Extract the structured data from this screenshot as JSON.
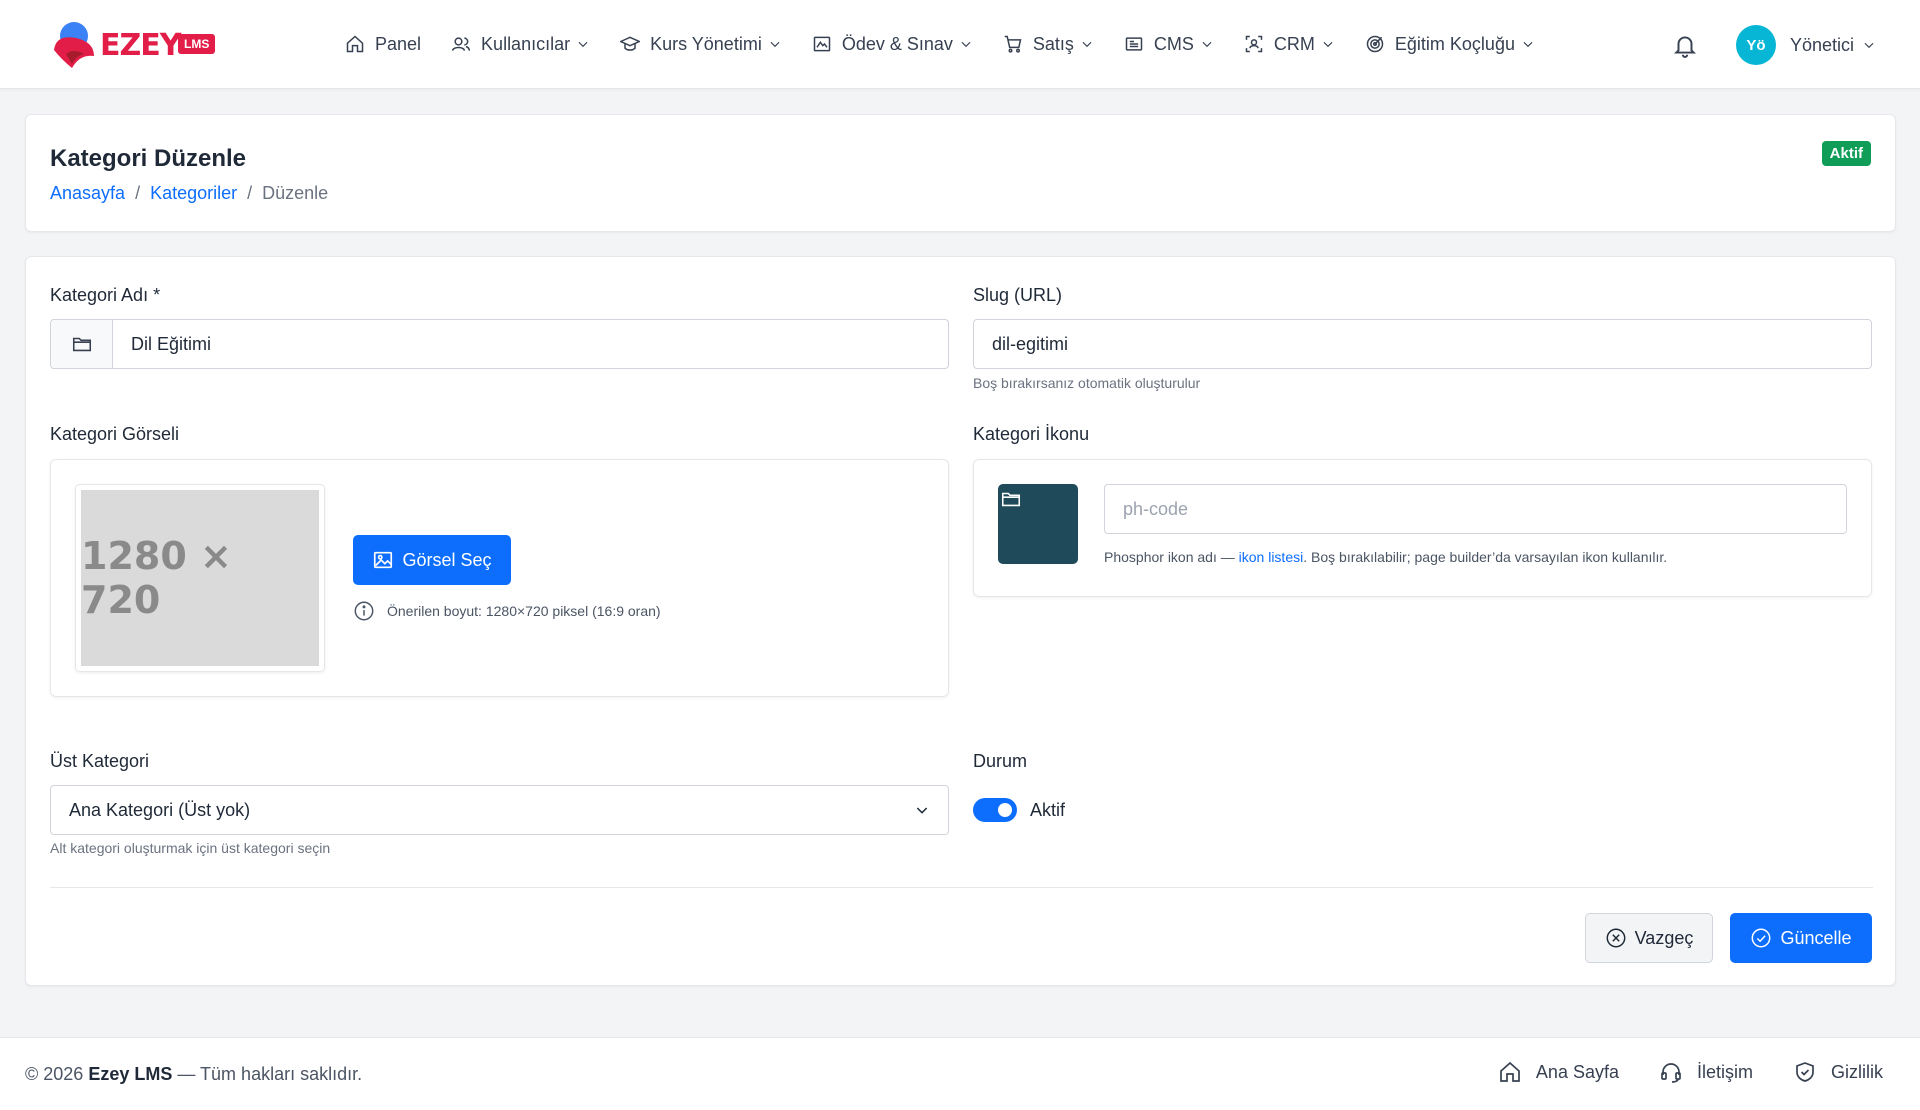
{
  "brand": {
    "name": "EZEY",
    "badge": "LMS"
  },
  "nav": {
    "items": [
      {
        "label": "Panel",
        "icon": "home-icon",
        "dropdown": false
      },
      {
        "label": "Kullanıcılar",
        "icon": "users-icon",
        "dropdown": true
      },
      {
        "label": "Kurs Yönetimi",
        "icon": "graduation-cap-icon",
        "dropdown": true
      },
      {
        "label": "Ödev & Sınav",
        "icon": "exam-icon",
        "dropdown": true
      },
      {
        "label": "Satış",
        "icon": "cart-icon",
        "dropdown": true
      },
      {
        "label": "CMS",
        "icon": "newspaper-icon",
        "dropdown": true
      },
      {
        "label": "CRM",
        "icon": "crm-icon",
        "dropdown": true
      },
      {
        "label": "Eğitim Koçluğu",
        "icon": "target-icon",
        "dropdown": true
      }
    ],
    "user": {
      "initials": "Yö",
      "name": "Yönetici"
    }
  },
  "header": {
    "title": "Kategori Düzenle",
    "breadcrumb": [
      "Anasayfa",
      "Kategoriler",
      "Düzenle"
    ],
    "status": "Aktif"
  },
  "form": {
    "name_label": "Kategori Adı *",
    "name_value": "Dil Eğitimi",
    "slug_label": "Slug (URL)",
    "slug_value": "dil-egitimi",
    "slug_help": "Boş bırakırsanız otomatik oluşturulur",
    "image_label": "Kategori Görseli",
    "image_placeholder": "1280 × 720",
    "image_button": "Görsel Seç",
    "image_hint": "Önerilen boyut: 1280×720 piksel (16:9 oran)",
    "icon_label": "Kategori İkonu",
    "icon_placeholder": "ph-code",
    "icon_help_prefix": "Phosphor ikon adı — ",
    "icon_help_link": "ikon listesi",
    "icon_help_suffix": ". Boş bırakılabilir; page builder’da varsayılan ikon kullanılır.",
    "icon_preview_color": "#1e4a5a",
    "parent_label": "Üst Kategori",
    "parent_value": "Ana Kategori (Üst yok)",
    "parent_help": "Alt kategori oluşturmak için üst kategori seçin",
    "status_label": "Durum",
    "status_toggle_label": "Aktif",
    "status_on": true,
    "cancel_label": "Vazgeç",
    "submit_label": "Güncelle"
  },
  "footer": {
    "year": "© 2026",
    "brand": "Ezey LMS",
    "rights": "— Tüm hakları saklıdır.",
    "links": [
      "Ana Sayfa",
      "İletişim",
      "Gizlilik"
    ]
  },
  "colors": {
    "primary": "#0d6efd",
    "brand": "#e11d48",
    "success": "#0f9d58",
    "avatar": "#06b6d4"
  }
}
